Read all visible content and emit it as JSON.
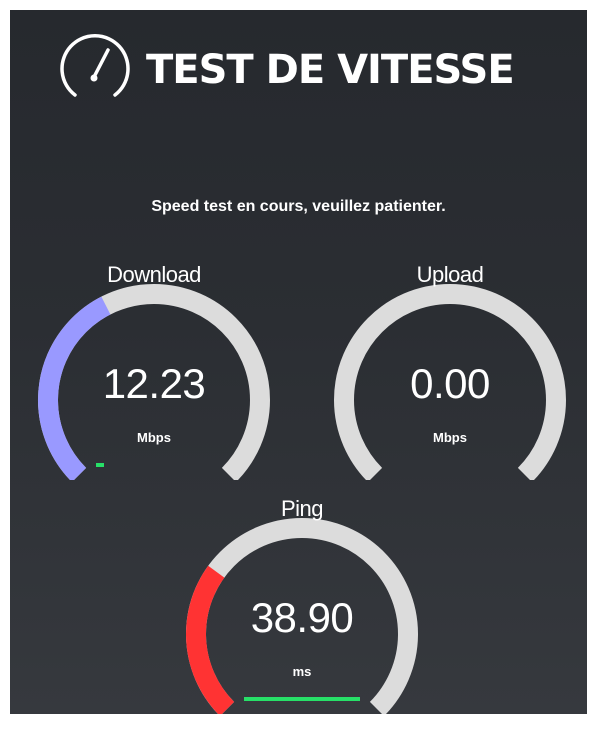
{
  "app": {
    "title": "TEST DE VITESSE",
    "icon": "speedometer-icon"
  },
  "status_text": "Speed test en cours, veuillez patienter.",
  "colors": {
    "background": "#2b2e33",
    "track": "#dcdcdc",
    "download_fill": "#9999ff",
    "ping_fill": "#ff3333",
    "progress": "#27e068"
  },
  "gauges": {
    "download": {
      "label": "Download",
      "value": "12.23",
      "unit": "Mbps",
      "gauge_fraction": 0.4,
      "progress_fraction": 0.07
    },
    "upload": {
      "label": "Upload",
      "value": "0.00",
      "unit": "Mbps",
      "gauge_fraction": 0,
      "progress_fraction": 0
    },
    "ping": {
      "label": "Ping",
      "value": "38.90",
      "unit": "ms",
      "gauge_fraction": 0.3,
      "progress_fraction": 1.0
    }
  }
}
